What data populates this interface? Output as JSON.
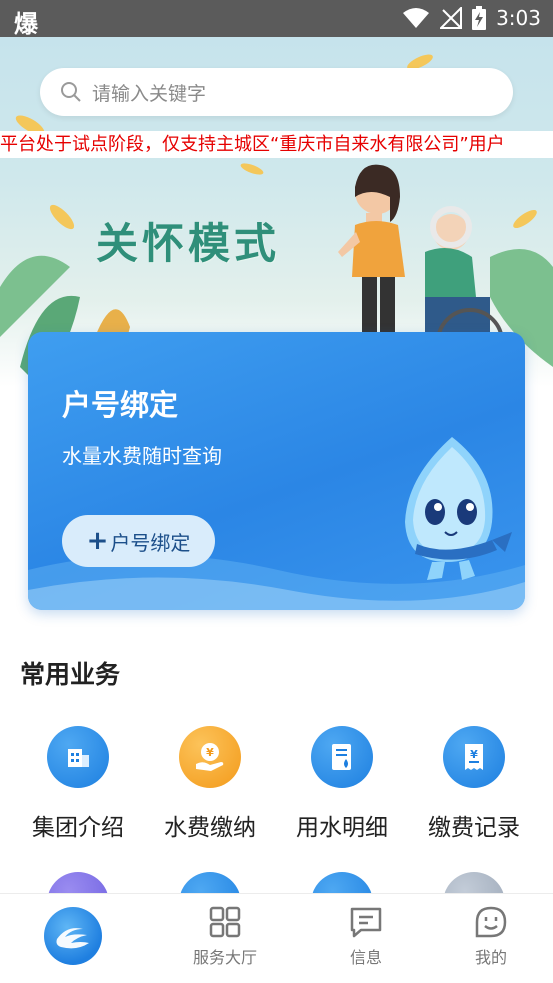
{
  "status_bar": {
    "app_glyph": "爆",
    "time": "3:03"
  },
  "search": {
    "placeholder": "请输入关键字"
  },
  "notice": {
    "text": "平台处于试点阶段，仅支持主城区“重庆市自来水有限公司”用户"
  },
  "banner": {
    "care_title": "关怀模式"
  },
  "bind_card": {
    "title": "户号绑定",
    "subtitle": "水量水费随时查询",
    "button_plus": "+",
    "button_label": "户号绑定"
  },
  "common": {
    "title": "常用业务",
    "items": [
      {
        "label": "集团介绍",
        "icon": "building-icon",
        "color": "#1d7fe0"
      },
      {
        "label": "水费缴纳",
        "icon": "yuan-hand-icon",
        "color": "#f5a623"
      },
      {
        "label": "用水明细",
        "icon": "water-document-icon",
        "color": "#1d7fe0"
      },
      {
        "label": "缴费记录",
        "icon": "yuan-receipt-icon",
        "color": "#1d7fe0"
      }
    ]
  },
  "bottom_nav": {
    "items": [
      {
        "label": "服务大厅",
        "icon": "grid-icon"
      },
      {
        "label": "信息",
        "icon": "message-icon"
      },
      {
        "label": "我的",
        "icon": "profile-icon"
      }
    ]
  },
  "colors": {
    "primary": "#1d7fe0",
    "notice_red": "#e60000",
    "care_green": "#2f8f7a",
    "orange": "#f5a623"
  }
}
